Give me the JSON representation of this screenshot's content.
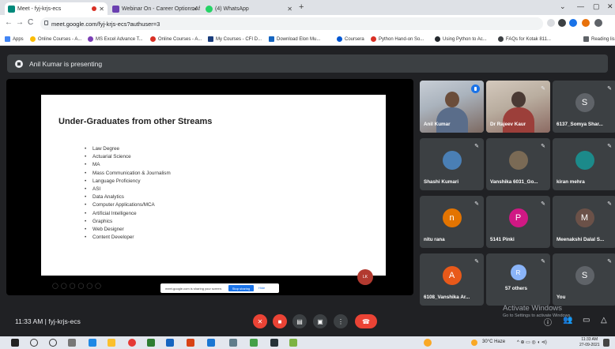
{
  "browser": {
    "tabs": [
      {
        "title": "Meet - fyj-krjs-ecs",
        "active": true
      },
      {
        "title": "Webinar On - Career Options Af",
        "active": false
      },
      {
        "title": "(4) WhatsApp",
        "active": false
      }
    ],
    "url": "meet.google.com/fyj-krjs-ecs?authuser=3",
    "bookmarks": [
      "Apps",
      "Online Courses - A...",
      "MS Excel Advance T...",
      "Online Courses - A...",
      "My Courses - CFI D...",
      "Download Elon Mu...",
      "Coursera",
      "Python Hand-on So...",
      "Using Python to Ac...",
      "FAQs for Kotak 811..."
    ],
    "reading_list": "Reading lis"
  },
  "meet": {
    "presenter_text": "Anil Kumar is presenting",
    "slide": {
      "title": "Under-Graduates from other Streams",
      "items": [
        "Law Degree",
        "Actuarial Science",
        "MA",
        "Mass Communication & Journalism",
        "Language Proficiency",
        "ASI",
        "Data Analytics",
        "Computer Applications/MCA",
        "Artificial Intelligence",
        "Graphics",
        "Web Designer",
        "Content Developer"
      ],
      "avatar_text": "LK"
    },
    "share_bar": {
      "text": "meet.google.com is sharing your screen.",
      "stop": "Stop sharing",
      "hide": "Hide"
    },
    "tiles": [
      {
        "name": "Anil Kumar",
        "initial": "",
        "color": ""
      },
      {
        "name": "Dr Rajeev Kaur",
        "initial": "",
        "color": ""
      },
      {
        "name": "6137_Somya Shar...",
        "initial": "S",
        "color": "#5f6368"
      },
      {
        "name": "Shashi Kumari",
        "initial": "",
        "color": "#4a7fb5"
      },
      {
        "name": "Vanshika 6031_Go...",
        "initial": "",
        "color": "#7a6a55"
      },
      {
        "name": "kiran mehra",
        "initial": "",
        "color": "#1c8a8a"
      },
      {
        "name": "nitu rana",
        "initial": "n",
        "color": "#e37400"
      },
      {
        "name": "5141 Pinki",
        "initial": "P",
        "color": "#d01884"
      },
      {
        "name": "Meenakshi Dalal S...",
        "initial": "M",
        "color": "#6b5148"
      },
      {
        "name": "6108_Vanshika Ar...",
        "initial": "A",
        "color": "#e8591a"
      },
      {
        "name": "57 others",
        "initial": "R",
        "color": "#8ab4f8"
      },
      {
        "name": "You",
        "initial": "S",
        "color": "#5f6368"
      }
    ],
    "meeting_time": "11:33 AM",
    "meeting_code": "fyj-krjs-ecs",
    "watermark": {
      "line1": "Activate Windows",
      "line2": "Go to Settings to activate Windows."
    }
  },
  "taskbar": {
    "weather": "30°C Haze",
    "time": "11:33 AM",
    "date": "27-09-2021"
  }
}
